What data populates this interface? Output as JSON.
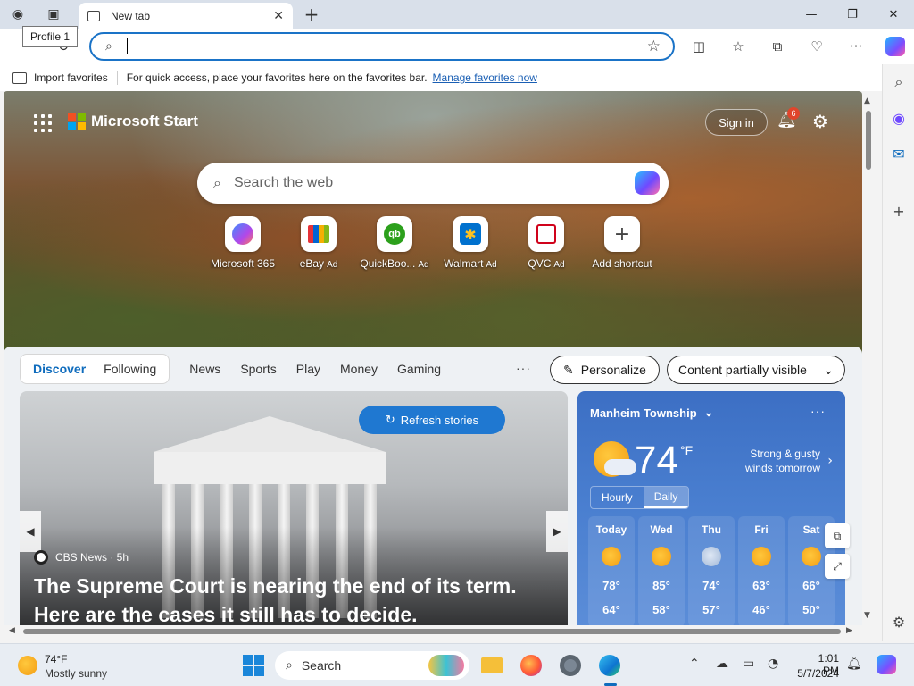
{
  "browser": {
    "tab_title": "New tab",
    "profile_tooltip": "Profile 1",
    "address_value": "",
    "favorites_bar": {
      "import_label": "Import favorites",
      "hint": "For quick access, place your favorites here on the favorites bar.",
      "manage_link": "Manage favorites now"
    }
  },
  "page": {
    "brand": "Microsoft Start",
    "sign_in": "Sign in",
    "notification_count": "6",
    "search_placeholder": "Search the web",
    "shortcuts": [
      {
        "label": "Microsoft 365",
        "ad": ""
      },
      {
        "label": "eBay",
        "ad": "Ad"
      },
      {
        "label": "QuickBoo...",
        "ad": "Ad"
      },
      {
        "label": "Walmart",
        "ad": "Ad"
      },
      {
        "label": "QVC",
        "ad": "Ad"
      },
      {
        "label": "Add shortcut",
        "ad": ""
      }
    ],
    "feed_nav": {
      "discover": "Discover",
      "following": "Following",
      "items": [
        "News",
        "Sports",
        "Play",
        "Money",
        "Gaming"
      ],
      "more": "···",
      "personalize": "Personalize",
      "content_visibility": "Content partially visible"
    },
    "story": {
      "refresh": "Refresh stories",
      "source": "CBS News · 5h",
      "headline": "The Supreme Court is nearing the end of its term. Here are the cases it still has to decide."
    },
    "weather": {
      "location": "Manheim Township",
      "temp": "74",
      "unit": "°F",
      "alert": "Strong & gusty winds tomorrow",
      "toggle": [
        "Hourly",
        "Daily"
      ],
      "days": [
        {
          "name": "Today",
          "hi": "78°",
          "lo": "64°",
          "icon": "partly-sunny"
        },
        {
          "name": "Wed",
          "hi": "85°",
          "lo": "58°",
          "icon": "partly-sunny"
        },
        {
          "name": "Thu",
          "hi": "74°",
          "lo": "57°",
          "icon": "rain"
        },
        {
          "name": "Fri",
          "hi": "63°",
          "lo": "46°",
          "icon": "partly-sunny"
        },
        {
          "name": "Sat",
          "hi": "66°",
          "lo": "50°",
          "icon": "partly-sunny"
        }
      ]
    }
  },
  "taskbar": {
    "weather_temp": "74°F",
    "weather_condition": "Mostly sunny",
    "search_label": "Search",
    "time": "1:01 PM",
    "date": "5/7/2024"
  }
}
